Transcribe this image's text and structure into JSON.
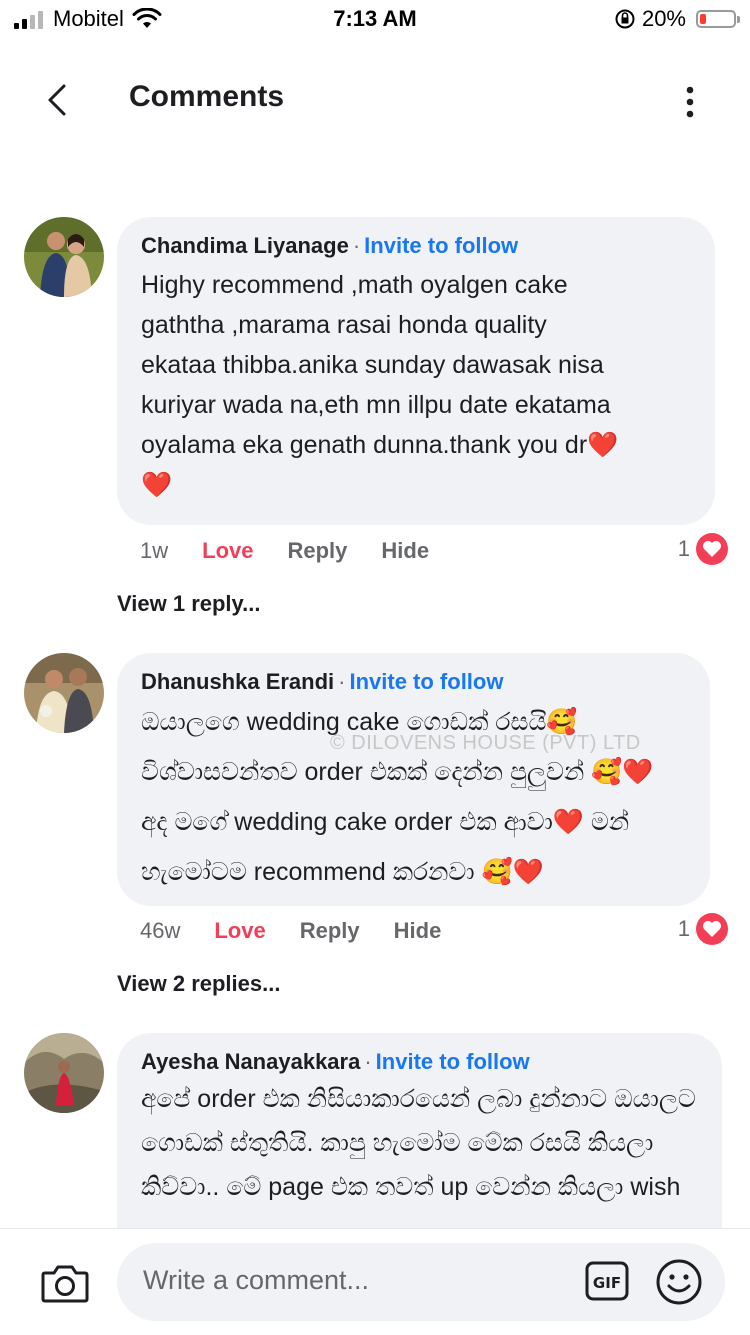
{
  "status_bar": {
    "carrier": "Mobitel",
    "time": "7:13 AM",
    "battery": "20%",
    "battery_level": 0.2
  },
  "header": {
    "title": "Comments"
  },
  "comments": [
    {
      "name": "Chandima Liyanage",
      "invite": "Invite to follow",
      "text": "Highy recommend ,math oyalgen cake\ngaththa ,marama rasai honda quality\nekataa thibba.anika sunday dawasak nisa\nkuriyar wada na,eth mn illpu date ekatama\noyalama eka genath dunna.thank you dr❤️\n❤️",
      "time": "1w",
      "love": "Love",
      "reply": "Reply",
      "hide": "Hide",
      "reactions": "1",
      "replies": "View 1 reply..."
    },
    {
      "name": "Dhanushka Erandi",
      "invite": "Invite to follow",
      "text": "ඔයාලගෙ wedding cake ගොඩක් රසයි🥰\nවිශ්වාසවන්තව order එකක් දෙන්න පුලුවන් 🥰❤️\nඅද මගේ wedding cake order  එක ආවා❤️ මන්\nහැමෝටම recommend කරනවා  🥰❤️",
      "time": "46w",
      "love": "Love",
      "reply": "Reply",
      "hide": "Hide",
      "reactions": "1",
      "replies": "View 2 replies..."
    },
    {
      "name": "Ayesha Nanayakkara",
      "invite": "Invite to follow",
      "text": "අපේ order එක නිසියාකාරයෙන් ලබා දුන්නාට ඔයාලට\nගොඩක් ස්තුතියි. කාපු හැමෝම මේක රසයි කියලා\nකිව්වා.. මේ page එක තවත් up වෙන්න කියලා wish"
    }
  ],
  "watermark": "© DILOVENS HOUSE (PVT) LTD",
  "composer": {
    "placeholder": "Write a comment..."
  },
  "icons": [
    "back-icon",
    "more-icon",
    "heart-icon",
    "camera-icon",
    "gif-icon",
    "emoji-icon",
    "wifi-icon",
    "signal-icon",
    "battery-icon",
    "rotation-lock-icon"
  ],
  "colors": {
    "accent": "#1877f2",
    "love": "#f33e58",
    "bubble": "#f0f2f5",
    "muted": "#65676b"
  }
}
